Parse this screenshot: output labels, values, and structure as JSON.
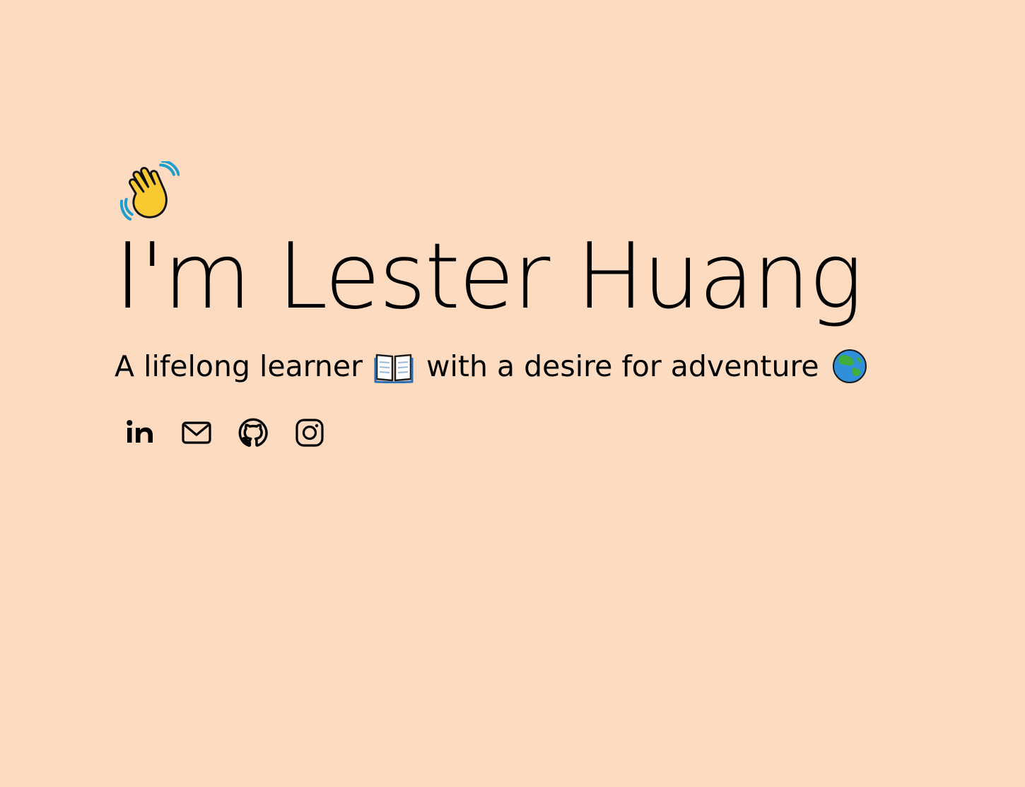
{
  "hero": {
    "greeting_icon": "waving-hand-icon",
    "name": "I'm Lester Huang",
    "tagline_part1": "A lifelong learner",
    "tagline_icon1": "open-book-icon",
    "tagline_part2": "with a desire for adventure",
    "tagline_icon2": "globe-asia-australia-icon"
  },
  "socials": [
    {
      "icon": "linkedin-icon",
      "label": "LinkedIn"
    },
    {
      "icon": "mail-icon",
      "label": "Email"
    },
    {
      "icon": "github-icon",
      "label": "GitHub"
    },
    {
      "icon": "instagram-icon",
      "label": "Instagram"
    }
  ],
  "colors": {
    "background": "#fddbc1",
    "text": "#000000"
  }
}
